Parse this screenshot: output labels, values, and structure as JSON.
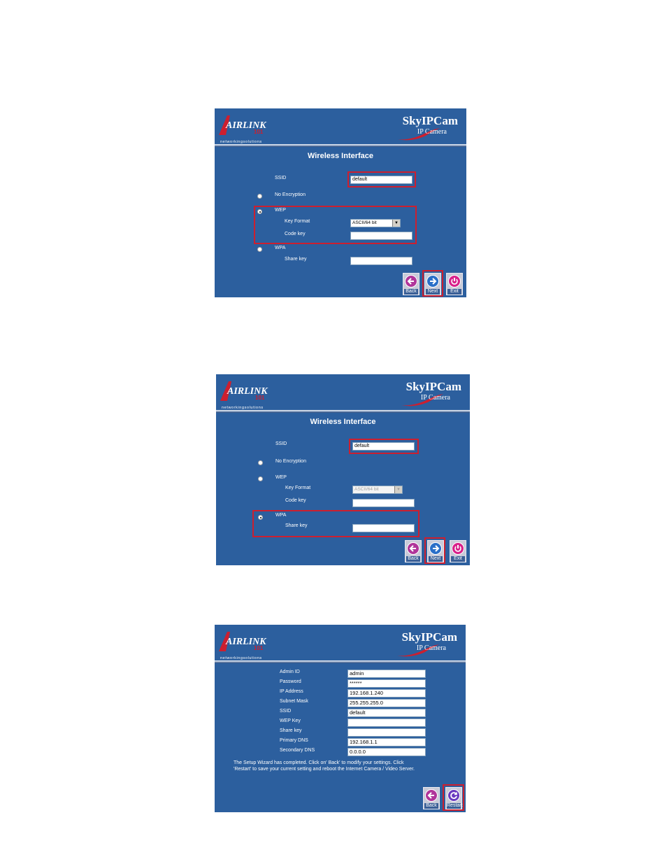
{
  "brand": {
    "logo_text": "AIRLINK",
    "logo_number": "101",
    "logo_tagline": "networkingsolutions",
    "product": "SkyIPCam",
    "product_sub": "IP Camera"
  },
  "screen_wep": {
    "title": "Wireless Interface",
    "ssid_label": "SSID",
    "ssid_value": "default",
    "no_encryption_label": "No Encryption",
    "wep_label": "WEP",
    "key_format_label": "Key Format",
    "key_format_value": "ASCII/64 bit",
    "code_key_label": "Code key",
    "wpa_label": "WPA",
    "share_key_label": "Share key",
    "back_label": "Back",
    "next_label": "Next",
    "exit_label": "Exit"
  },
  "screen_wpa": {
    "title": "Wireless Interface",
    "ssid_label": "SSID",
    "ssid_value": "default",
    "no_encryption_label": "No Encryption",
    "wep_label": "WEP",
    "key_format_label": "Key Format",
    "key_format_value": "ASCII/64 bit",
    "code_key_label": "Code key",
    "wpa_label": "WPA",
    "share_key_label": "Share key",
    "back_label": "Back",
    "next_label": "Next",
    "exit_label": "Exit"
  },
  "screen_summary": {
    "rows": [
      {
        "label": "Admin ID",
        "value": "admin"
      },
      {
        "label": "Password",
        "value": "******"
      },
      {
        "label": "IP Address",
        "value": "192.168.1.240"
      },
      {
        "label": "Subnet Mask",
        "value": "255.255.255.0"
      },
      {
        "label": "SSID",
        "value": "default"
      },
      {
        "label": "WEP Key",
        "value": ""
      },
      {
        "label": "Share key",
        "value": ""
      },
      {
        "label": "Primary DNS",
        "value": "192.168.1.1"
      },
      {
        "label": "Secondary DNS",
        "value": "0.0.0.0"
      }
    ],
    "instruction_line1": "The Setup Wizard has completed. Click on' Back' to modify your settings. Click",
    "instruction_line2": "'Restart' to save your current setting and reboot the Internet Camera / Video Server.",
    "back_label": "Back",
    "restart_label": "Restart"
  },
  "colors": {
    "panel_bg": "#2c5f9e",
    "highlight": "#cc1f2f"
  }
}
